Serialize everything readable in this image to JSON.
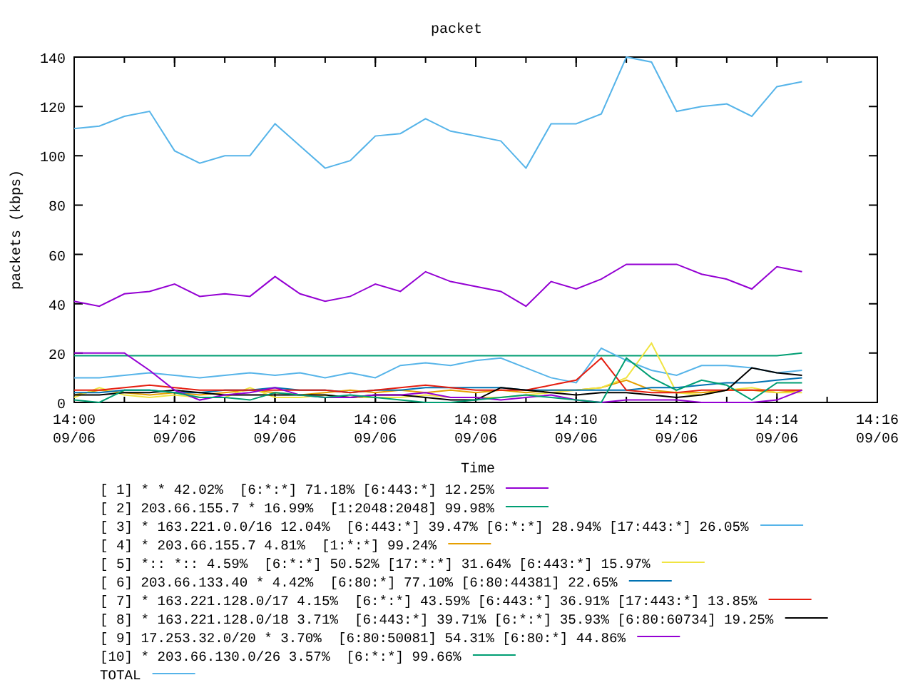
{
  "chart_data": {
    "type": "line",
    "title": "packet",
    "xlabel": "Time",
    "ylabel": "packets (kbps)",
    "categories": [
      "14:00 09/06",
      null,
      null,
      null,
      "14:02 09/06",
      null,
      null,
      null,
      "14:04 09/06",
      null,
      null,
      null,
      "14:06 09/06",
      null,
      null,
      null,
      "14:08 09/06",
      null,
      null,
      null,
      "14:10 09/06",
      null,
      null,
      null,
      "14:12 09/06",
      null,
      null,
      null,
      "14:14 09/06",
      null,
      null,
      null,
      "14:16 09/06"
    ],
    "ylim": [
      0,
      140
    ],
    "legend": "bottom",
    "yticks": [
      0,
      20,
      40,
      60,
      80,
      100,
      120,
      140
    ],
    "series": [
      {
        "name": "[ 1] * * 42.02%  [6:*:*] 71.18% [6:443:*] 12.25%",
        "color": "#9400d3",
        "values": [
          41,
          39,
          44,
          45,
          48,
          43,
          44,
          43,
          51,
          44,
          41,
          43,
          48,
          45,
          53,
          49,
          47,
          45,
          39,
          49,
          46,
          50,
          56,
          56,
          56,
          52,
          50,
          46,
          55,
          53,
          null,
          null,
          null
        ]
      },
      {
        "name": "[ 2] 203.66.155.7 * 16.99%  [1:2048:2048] 99.98%",
        "color": "#009e73",
        "values": [
          19,
          19,
          19,
          19,
          19,
          19,
          19,
          19,
          19,
          19,
          19,
          19,
          19,
          19,
          19,
          19,
          19,
          19,
          19,
          19,
          19,
          19,
          19,
          19,
          19,
          19,
          19,
          19,
          19,
          20,
          null,
          null,
          null
        ]
      },
      {
        "name": "[ 3] * 163.221.0.0/16 12.04%  [6:443:*] 39.47% [6:*:*] 28.94% [17:443:*] 26.05%",
        "color": "#56b4e9",
        "values": [
          10,
          10,
          11,
          12,
          11,
          10,
          11,
          12,
          11,
          12,
          10,
          12,
          10,
          15,
          16,
          15,
          17,
          18,
          14,
          10,
          8,
          22,
          17,
          13,
          11,
          15,
          15,
          14,
          12,
          13,
          null,
          null,
          null
        ]
      },
      {
        "name": "[ 4] * 203.66.155.7 4.81%  [1:*:*] 99.24%",
        "color": "#e69f00",
        "values": [
          3,
          5,
          4,
          3,
          4,
          3,
          4,
          5,
          4,
          3,
          4,
          5,
          4,
          5,
          4,
          5,
          4,
          5,
          4,
          5,
          5,
          6,
          9,
          5,
          4,
          4,
          5,
          5,
          4,
          5,
          null,
          null,
          null
        ]
      },
      {
        "name": "[ 5] *:: *:: 4.59%  [6:*:*] 50.52% [17:*:*] 31.64% [6:443:*] 15.97%",
        "color": "#f0e442",
        "values": [
          2,
          6,
          3,
          2,
          3,
          2,
          2,
          6,
          2,
          2,
          3,
          2,
          2,
          2,
          3,
          2,
          2,
          2,
          3,
          4,
          5,
          6,
          10,
          24,
          4,
          3,
          5,
          6,
          4,
          4,
          null,
          null,
          null
        ]
      },
      {
        "name": "[ 6] 203.66.133.40 * 4.42%  [6:80:*] 77.10% [6:80:44381] 22.65%",
        "color": "#0072b2",
        "values": [
          4,
          4,
          5,
          5,
          4,
          4,
          5,
          5,
          6,
          5,
          5,
          4,
          5,
          5,
          6,
          6,
          6,
          6,
          5,
          5,
          5,
          5,
          5,
          6,
          6,
          7,
          8,
          8,
          9,
          10,
          null,
          null,
          null
        ]
      },
      {
        "name": "[ 7] * 163.221.128.0/17 4.15%  [6:*:*] 43.59% [6:443:*] 36.91% [17:443:*] 13.85%",
        "color": "#e51e10",
        "values": [
          5,
          5,
          6,
          7,
          6,
          5,
          5,
          5,
          5,
          5,
          5,
          4,
          5,
          6,
          7,
          6,
          5,
          5,
          5,
          7,
          9,
          18,
          5,
          4,
          4,
          5,
          5,
          5,
          5,
          5,
          null,
          null,
          null
        ]
      },
      {
        "name": "[ 8] * 163.221.128.0/18 3.71%  [6:443:*] 39.71% [6:*:*] 35.93% [6:80:60734] 19.25%",
        "color": "#000000",
        "values": [
          3,
          3,
          4,
          4,
          5,
          4,
          3,
          3,
          3,
          3,
          3,
          2,
          3,
          3,
          2,
          1,
          1,
          6,
          5,
          4,
          3,
          4,
          4,
          3,
          2,
          3,
          5,
          14,
          12,
          11,
          null,
          null,
          null
        ]
      },
      {
        "name": "[ 9] 17.253.32.0/20 * 3.70%  [6:80:50081] 54.31% [6:80:*] 44.86%",
        "color": "#9400d3",
        "values": [
          20,
          20,
          20,
          13,
          5,
          1,
          3,
          4,
          6,
          3,
          2,
          2,
          3,
          3,
          4,
          2,
          2,
          1,
          2,
          3,
          1,
          0,
          1,
          1,
          1,
          0,
          0,
          0,
          1,
          5,
          null,
          null,
          null
        ]
      },
      {
        "name": "[10] * 203.66.130.0/26 3.57%  [6:*:*] 99.66%",
        "color": "#009e73",
        "values": [
          1,
          0,
          5,
          5,
          4,
          2,
          2,
          1,
          4,
          3,
          2,
          3,
          2,
          1,
          0,
          0,
          1,
          2,
          3,
          2,
          1,
          0,
          18,
          10,
          5,
          9,
          7,
          1,
          8,
          8,
          null,
          null,
          null
        ]
      },
      {
        "name": "TOTAL",
        "color": "#56b4e9",
        "values": [
          111,
          112,
          116,
          118,
          102,
          97,
          100,
          100,
          113,
          104,
          95,
          98,
          108,
          109,
          115,
          110,
          108,
          106,
          95,
          113,
          113,
          117,
          140,
          138,
          118,
          120,
          121,
          116,
          128,
          130,
          null,
          null,
          null
        ]
      }
    ]
  }
}
